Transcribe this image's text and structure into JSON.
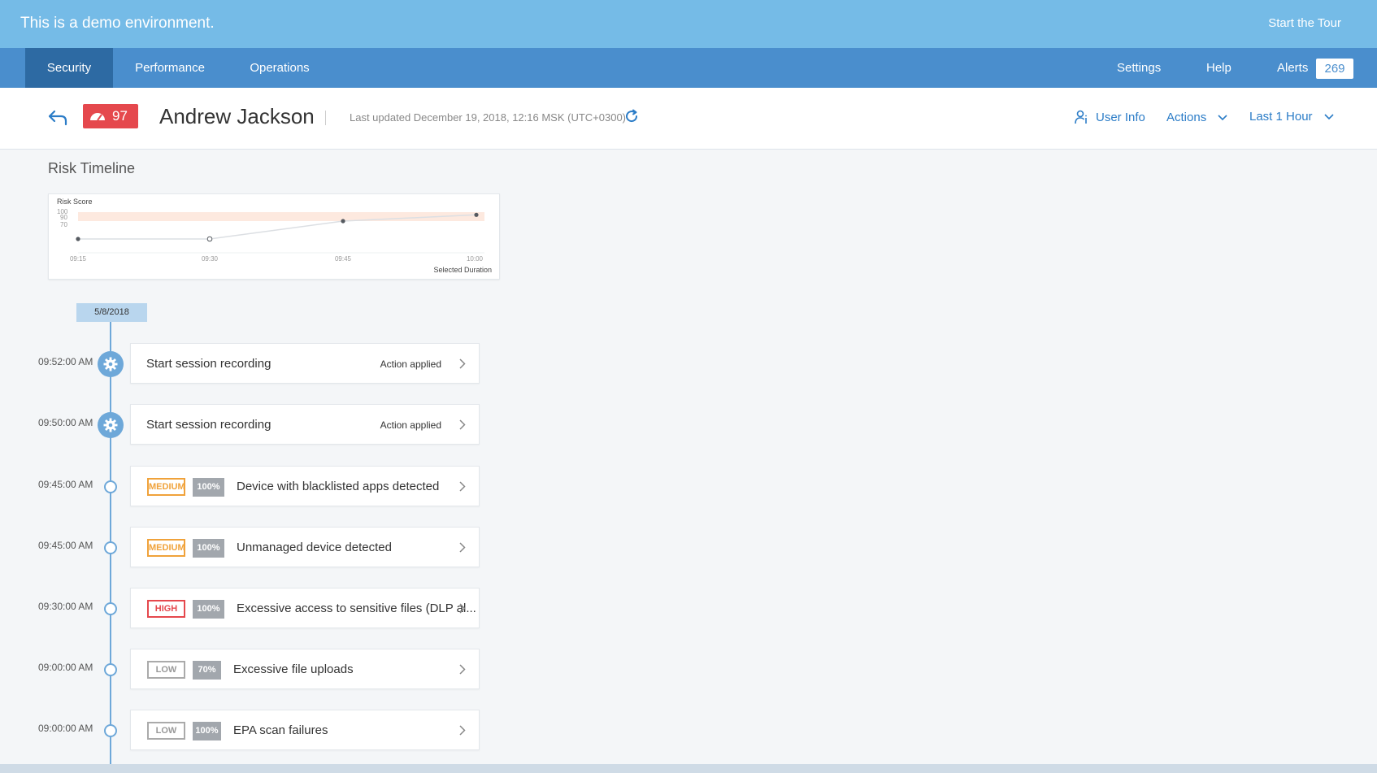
{
  "banner": {
    "message": "This is a demo environment.",
    "tour_label": "Start the Tour"
  },
  "nav": {
    "tabs": [
      {
        "label": "Security",
        "active": true
      },
      {
        "label": "Performance",
        "active": false
      },
      {
        "label": "Operations",
        "active": false
      }
    ],
    "settings_label": "Settings",
    "help_label": "Help",
    "alerts_label": "Alerts",
    "alerts_count": "269"
  },
  "header": {
    "risk_score": "97",
    "user_name": "Andrew Jackson",
    "last_updated": "Last updated December 19, 2018, 12:16 MSK (UTC+0300)",
    "user_info_label": "User Info",
    "actions_label": "Actions",
    "time_range_label": "Last 1 Hour"
  },
  "risk_timeline": {
    "title": "Risk Timeline",
    "date": "5/8/2018"
  },
  "chart_data": {
    "type": "line",
    "ylabel": "Risk Score",
    "y_ticks": [
      "100",
      "90",
      "70"
    ],
    "x": [
      "09:15",
      "09:30",
      "09:45",
      "10:00"
    ],
    "values": [
      70,
      70,
      90,
      97
    ],
    "legend": "Selected Duration",
    "band": [
      90,
      100
    ],
    "colors": {
      "band": "#fde9df",
      "line": "#dcdfe3",
      "point": "#555a60"
    }
  },
  "events": [
    {
      "time": "09:52:00 AM",
      "kind": "action",
      "title": "Start session recording",
      "status": "Action applied"
    },
    {
      "time": "09:50:00 AM",
      "kind": "action",
      "title": "Start session recording",
      "status": "Action applied"
    },
    {
      "time": "09:45:00 AM",
      "kind": "risk",
      "severity": "MEDIUM",
      "severity_class": "medium",
      "percent": "100%",
      "title": "Device with blacklisted apps detected"
    },
    {
      "time": "09:45:00 AM",
      "kind": "risk",
      "severity": "MEDIUM",
      "severity_class": "medium",
      "percent": "100%",
      "title": "Unmanaged device detected"
    },
    {
      "time": "09:30:00 AM",
      "kind": "risk",
      "severity": "HIGH",
      "severity_class": "high",
      "percent": "100%",
      "title": "Excessive access to sensitive files (DLP al..."
    },
    {
      "time": "09:00:00 AM",
      "kind": "risk",
      "severity": "LOW",
      "severity_class": "low",
      "percent": "70%",
      "title": "Excessive file uploads"
    },
    {
      "time": "09:00:00 AM",
      "kind": "risk",
      "severity": "LOW",
      "severity_class": "low",
      "percent": "100%",
      "title": "EPA scan failures"
    }
  ],
  "colors": {
    "banner": "#75bbe7",
    "nav": "#4a8ecd",
    "nav_active": "#2d6aa3",
    "link": "#2b7cc7",
    "risk": "#e5484d"
  }
}
